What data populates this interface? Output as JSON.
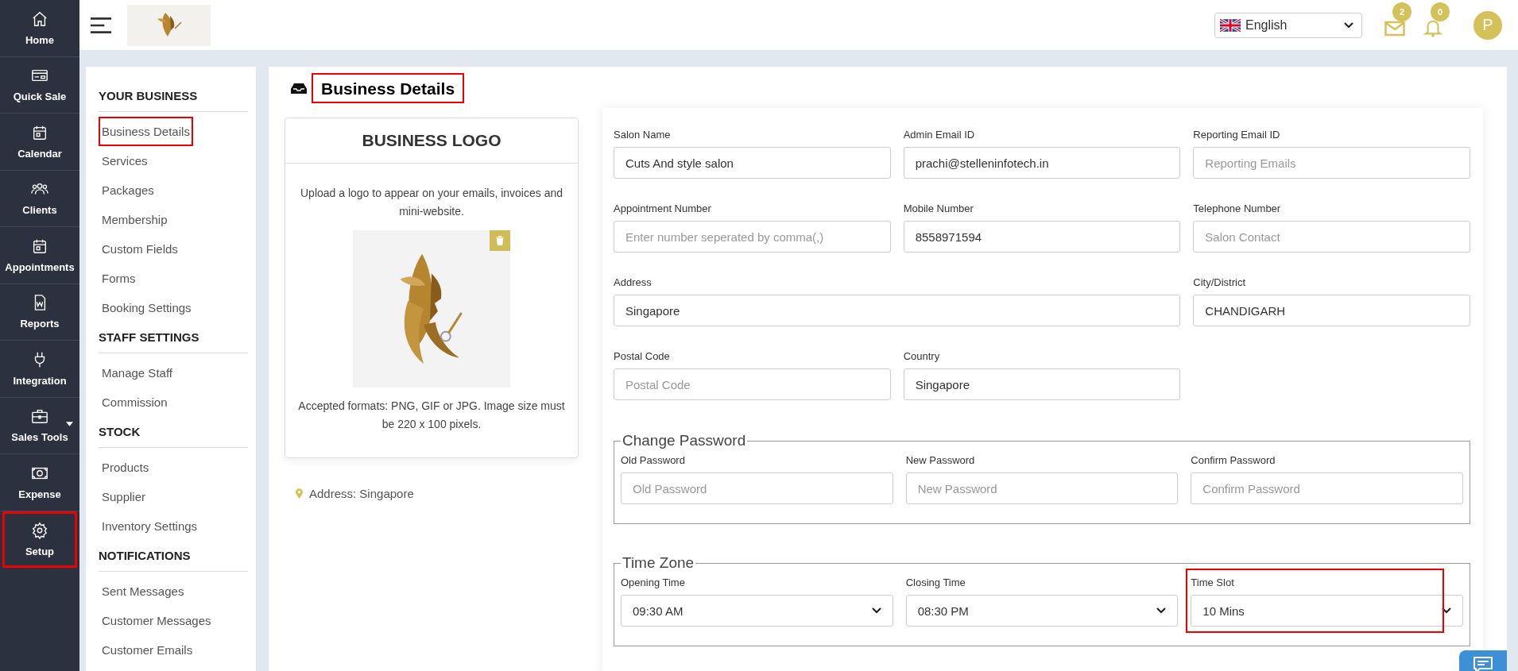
{
  "nav": [
    {
      "label": "Home",
      "highlighted": false
    },
    {
      "label": "Quick Sale",
      "highlighted": false
    },
    {
      "label": "Calendar",
      "highlighted": false
    },
    {
      "label": "Clients",
      "highlighted": false
    },
    {
      "label": "Appointments",
      "highlighted": false
    },
    {
      "label": "Reports",
      "highlighted": false
    },
    {
      "label": "Integration",
      "highlighted": false
    },
    {
      "label": "Sales Tools",
      "highlighted": false,
      "dropdown": true
    },
    {
      "label": "Expense",
      "highlighted": false
    },
    {
      "label": "Setup",
      "highlighted": true
    }
  ],
  "header": {
    "language": "English",
    "mail_count": "2",
    "notification_count": "0",
    "avatar": "P"
  },
  "settings_menu": [
    {
      "heading": "YOUR BUSINESS",
      "items": [
        {
          "label": "Business Details",
          "highlighted": true
        },
        {
          "label": "Services",
          "highlighted": false
        },
        {
          "label": "Packages",
          "highlighted": false
        },
        {
          "label": "Membership",
          "highlighted": false
        },
        {
          "label": "Custom Fields",
          "highlighted": false
        },
        {
          "label": "Forms",
          "highlighted": false
        },
        {
          "label": "Booking Settings",
          "highlighted": false
        }
      ]
    },
    {
      "heading": "STAFF SETTINGS",
      "items": [
        {
          "label": "Manage Staff",
          "highlighted": false
        },
        {
          "label": "Commission",
          "highlighted": false
        }
      ]
    },
    {
      "heading": "STOCK",
      "items": [
        {
          "label": "Products",
          "highlighted": false
        },
        {
          "label": "Supplier",
          "highlighted": false
        },
        {
          "label": "Inventory Settings",
          "highlighted": false
        }
      ]
    },
    {
      "heading": "NOTIFICATIONS",
      "items": [
        {
          "label": "Sent Messages",
          "highlighted": false
        },
        {
          "label": "Customer Messages",
          "highlighted": false
        },
        {
          "label": "Customer Emails",
          "highlighted": false
        }
      ]
    }
  ],
  "page_title": {
    "text": "Business Details",
    "highlighted": true
  },
  "logo_card": {
    "title": "BUSINESS LOGO",
    "description": "Upload a logo to appear on your emails, invoices and mini-website.",
    "formats": "Accepted formats: PNG, GIF or JPG. Image size must be 220 x 100 pixels."
  },
  "address_line": "Address: Singapore",
  "business_fields": [
    {
      "label": "Salon Name",
      "kind": "input",
      "value": "Cuts And style salon"
    },
    {
      "label": "Admin Email ID",
      "kind": "input",
      "value": "prachi@stelleninfotech.in"
    },
    {
      "label": "Reporting Email ID",
      "kind": "input",
      "placeholder": "Reporting Emails"
    },
    {
      "label": "Appointment Number",
      "kind": "input",
      "placeholder": "Enter number seperated by comma(,)"
    },
    {
      "label": "Mobile Number",
      "kind": "input",
      "value": "8558971594"
    },
    {
      "label": "Telephone Number",
      "kind": "input",
      "placeholder": "Salon Contact"
    },
    {
      "label": "Address",
      "kind": "wide-input",
      "value": "Singapore"
    },
    {
      "label": "City/District",
      "kind": "input",
      "value": "CHANDIGARH"
    },
    {
      "label": "Postal Code",
      "kind": "input",
      "placeholder": "Postal Code"
    },
    {
      "label": "Country",
      "kind": "input",
      "value": "Singapore"
    }
  ],
  "sections": [
    {
      "legend": "Change Password",
      "fields": [
        {
          "label": "Old Password",
          "kind": "input",
          "placeholder": "Old Password",
          "highlighted": false
        },
        {
          "label": "New Password",
          "kind": "input",
          "placeholder": "New Password",
          "highlighted": false
        },
        {
          "label": "Confirm Password",
          "kind": "input",
          "placeholder": "Confirm Password",
          "highlighted": false
        }
      ]
    },
    {
      "legend": "Time Zone",
      "fields": [
        {
          "label": "Opening Time",
          "kind": "select",
          "value": "09:30 AM",
          "highlighted": false
        },
        {
          "label": "Closing Time",
          "kind": "select",
          "value": "08:30 PM",
          "highlighted": false
        },
        {
          "label": "Time Slot",
          "kind": "select",
          "value": "10 Mins",
          "highlighted": true
        }
      ]
    }
  ]
}
